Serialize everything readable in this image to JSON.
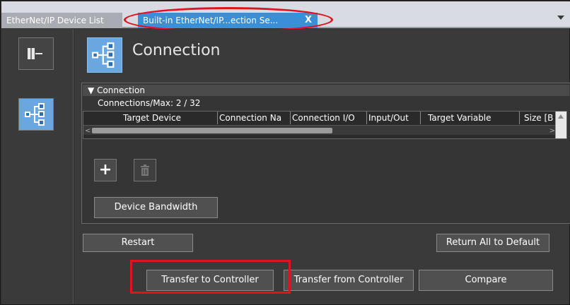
{
  "tabs": [
    {
      "label": "EtherNet/IP Device List",
      "active": false
    },
    {
      "label": "Built-in EtherNet/IP...ection Se...",
      "active": true,
      "close_label": "X"
    }
  ],
  "sidebar": {
    "items": [
      {
        "name": "device-view",
        "icon": "device-icon"
      },
      {
        "name": "connection-view",
        "icon": "connection-tree-icon",
        "selected": true
      }
    ]
  },
  "header": {
    "title": "Connection",
    "icon": "connection-tree-icon"
  },
  "section": {
    "title": "Connection",
    "expanded_glyph": "▼",
    "connections_max": "Connections/Max: 2 / 32"
  },
  "table": {
    "columns": [
      "Target Device",
      "Connection Na",
      "Connection I/O",
      "Input/Out",
      "Target Variable",
      "Size [B"
    ]
  },
  "buttons": {
    "add_glyph": "+",
    "device_bandwidth": "Device Bandwidth",
    "restart": "Restart",
    "return_all_default": "Return All to Default",
    "transfer_to_controller": "Transfer to Controller",
    "transfer_from_controller": "Transfer from Controller",
    "compare": "Compare"
  },
  "colors": {
    "accent_blue": "#3a8fd6",
    "highlight_red": "#e0141e",
    "panel_dark": "#3a3a3a"
  }
}
